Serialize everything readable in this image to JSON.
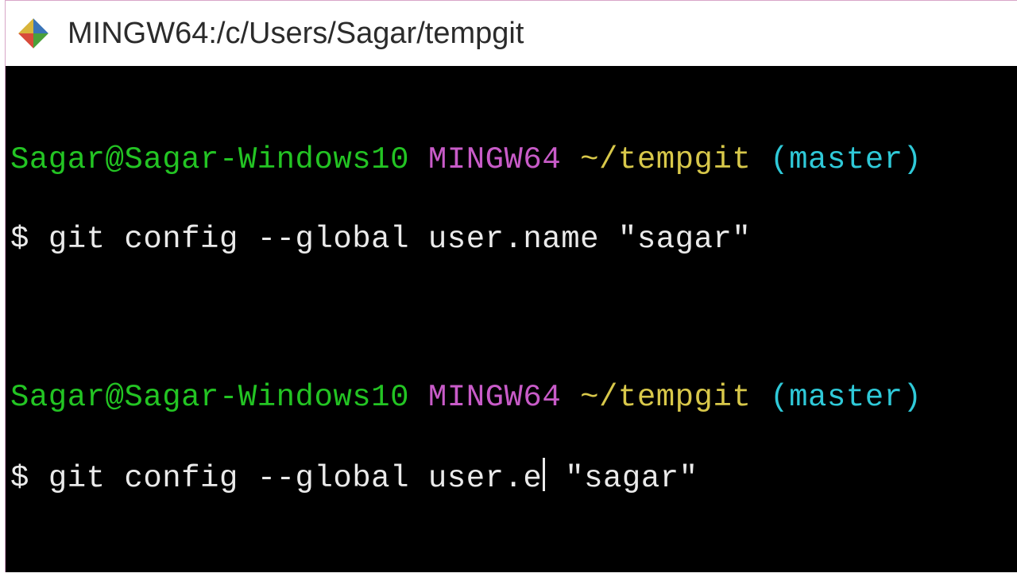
{
  "window": {
    "title": "MINGW64:/c/Users/Sagar/tempgit"
  },
  "prompt": {
    "user": "Sagar@Sagar-Windows10",
    "env": "MINGW64",
    "path": "~/tempgit",
    "branch": "(master)",
    "symbol": "$"
  },
  "lines": {
    "cmd1": "git config --global user.name \"sagar\"",
    "cmd2_before_cursor": "git config --global user.e",
    "cmd2_after_cursor": " \"sagar\""
  }
}
